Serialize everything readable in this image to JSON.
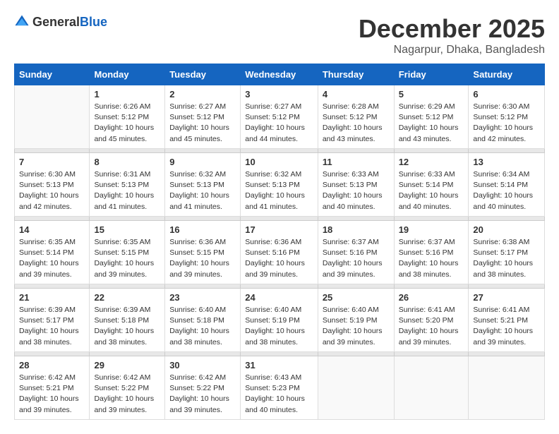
{
  "logo": {
    "general": "General",
    "blue": "Blue"
  },
  "header": {
    "month": "December 2025",
    "location": "Nagarpur, Dhaka, Bangladesh"
  },
  "days_of_week": [
    "Sunday",
    "Monday",
    "Tuesday",
    "Wednesday",
    "Thursday",
    "Friday",
    "Saturday"
  ],
  "weeks": [
    [
      {
        "day": "",
        "sunrise": "",
        "sunset": "",
        "daylight": ""
      },
      {
        "day": "1",
        "sunrise": "Sunrise: 6:26 AM",
        "sunset": "Sunset: 5:12 PM",
        "daylight": "Daylight: 10 hours and 45 minutes."
      },
      {
        "day": "2",
        "sunrise": "Sunrise: 6:27 AM",
        "sunset": "Sunset: 5:12 PM",
        "daylight": "Daylight: 10 hours and 45 minutes."
      },
      {
        "day": "3",
        "sunrise": "Sunrise: 6:27 AM",
        "sunset": "Sunset: 5:12 PM",
        "daylight": "Daylight: 10 hours and 44 minutes."
      },
      {
        "day": "4",
        "sunrise": "Sunrise: 6:28 AM",
        "sunset": "Sunset: 5:12 PM",
        "daylight": "Daylight: 10 hours and 43 minutes."
      },
      {
        "day": "5",
        "sunrise": "Sunrise: 6:29 AM",
        "sunset": "Sunset: 5:12 PM",
        "daylight": "Daylight: 10 hours and 43 minutes."
      },
      {
        "day": "6",
        "sunrise": "Sunrise: 6:30 AM",
        "sunset": "Sunset: 5:12 PM",
        "daylight": "Daylight: 10 hours and 42 minutes."
      }
    ],
    [
      {
        "day": "7",
        "sunrise": "Sunrise: 6:30 AM",
        "sunset": "Sunset: 5:13 PM",
        "daylight": "Daylight: 10 hours and 42 minutes."
      },
      {
        "day": "8",
        "sunrise": "Sunrise: 6:31 AM",
        "sunset": "Sunset: 5:13 PM",
        "daylight": "Daylight: 10 hours and 41 minutes."
      },
      {
        "day": "9",
        "sunrise": "Sunrise: 6:32 AM",
        "sunset": "Sunset: 5:13 PM",
        "daylight": "Daylight: 10 hours and 41 minutes."
      },
      {
        "day": "10",
        "sunrise": "Sunrise: 6:32 AM",
        "sunset": "Sunset: 5:13 PM",
        "daylight": "Daylight: 10 hours and 41 minutes."
      },
      {
        "day": "11",
        "sunrise": "Sunrise: 6:33 AM",
        "sunset": "Sunset: 5:13 PM",
        "daylight": "Daylight: 10 hours and 40 minutes."
      },
      {
        "day": "12",
        "sunrise": "Sunrise: 6:33 AM",
        "sunset": "Sunset: 5:14 PM",
        "daylight": "Daylight: 10 hours and 40 minutes."
      },
      {
        "day": "13",
        "sunrise": "Sunrise: 6:34 AM",
        "sunset": "Sunset: 5:14 PM",
        "daylight": "Daylight: 10 hours and 40 minutes."
      }
    ],
    [
      {
        "day": "14",
        "sunrise": "Sunrise: 6:35 AM",
        "sunset": "Sunset: 5:14 PM",
        "daylight": "Daylight: 10 hours and 39 minutes."
      },
      {
        "day": "15",
        "sunrise": "Sunrise: 6:35 AM",
        "sunset": "Sunset: 5:15 PM",
        "daylight": "Daylight: 10 hours and 39 minutes."
      },
      {
        "day": "16",
        "sunrise": "Sunrise: 6:36 AM",
        "sunset": "Sunset: 5:15 PM",
        "daylight": "Daylight: 10 hours and 39 minutes."
      },
      {
        "day": "17",
        "sunrise": "Sunrise: 6:36 AM",
        "sunset": "Sunset: 5:16 PM",
        "daylight": "Daylight: 10 hours and 39 minutes."
      },
      {
        "day": "18",
        "sunrise": "Sunrise: 6:37 AM",
        "sunset": "Sunset: 5:16 PM",
        "daylight": "Daylight: 10 hours and 39 minutes."
      },
      {
        "day": "19",
        "sunrise": "Sunrise: 6:37 AM",
        "sunset": "Sunset: 5:16 PM",
        "daylight": "Daylight: 10 hours and 38 minutes."
      },
      {
        "day": "20",
        "sunrise": "Sunrise: 6:38 AM",
        "sunset": "Sunset: 5:17 PM",
        "daylight": "Daylight: 10 hours and 38 minutes."
      }
    ],
    [
      {
        "day": "21",
        "sunrise": "Sunrise: 6:39 AM",
        "sunset": "Sunset: 5:17 PM",
        "daylight": "Daylight: 10 hours and 38 minutes."
      },
      {
        "day": "22",
        "sunrise": "Sunrise: 6:39 AM",
        "sunset": "Sunset: 5:18 PM",
        "daylight": "Daylight: 10 hours and 38 minutes."
      },
      {
        "day": "23",
        "sunrise": "Sunrise: 6:40 AM",
        "sunset": "Sunset: 5:18 PM",
        "daylight": "Daylight: 10 hours and 38 minutes."
      },
      {
        "day": "24",
        "sunrise": "Sunrise: 6:40 AM",
        "sunset": "Sunset: 5:19 PM",
        "daylight": "Daylight: 10 hours and 38 minutes."
      },
      {
        "day": "25",
        "sunrise": "Sunrise: 6:40 AM",
        "sunset": "Sunset: 5:19 PM",
        "daylight": "Daylight: 10 hours and 39 minutes."
      },
      {
        "day": "26",
        "sunrise": "Sunrise: 6:41 AM",
        "sunset": "Sunset: 5:20 PM",
        "daylight": "Daylight: 10 hours and 39 minutes."
      },
      {
        "day": "27",
        "sunrise": "Sunrise: 6:41 AM",
        "sunset": "Sunset: 5:21 PM",
        "daylight": "Daylight: 10 hours and 39 minutes."
      }
    ],
    [
      {
        "day": "28",
        "sunrise": "Sunrise: 6:42 AM",
        "sunset": "Sunset: 5:21 PM",
        "daylight": "Daylight: 10 hours and 39 minutes."
      },
      {
        "day": "29",
        "sunrise": "Sunrise: 6:42 AM",
        "sunset": "Sunset: 5:22 PM",
        "daylight": "Daylight: 10 hours and 39 minutes."
      },
      {
        "day": "30",
        "sunrise": "Sunrise: 6:42 AM",
        "sunset": "Sunset: 5:22 PM",
        "daylight": "Daylight: 10 hours and 39 minutes."
      },
      {
        "day": "31",
        "sunrise": "Sunrise: 6:43 AM",
        "sunset": "Sunset: 5:23 PM",
        "daylight": "Daylight: 10 hours and 40 minutes."
      },
      {
        "day": "",
        "sunrise": "",
        "sunset": "",
        "daylight": ""
      },
      {
        "day": "",
        "sunrise": "",
        "sunset": "",
        "daylight": ""
      },
      {
        "day": "",
        "sunrise": "",
        "sunset": "",
        "daylight": ""
      }
    ]
  ]
}
